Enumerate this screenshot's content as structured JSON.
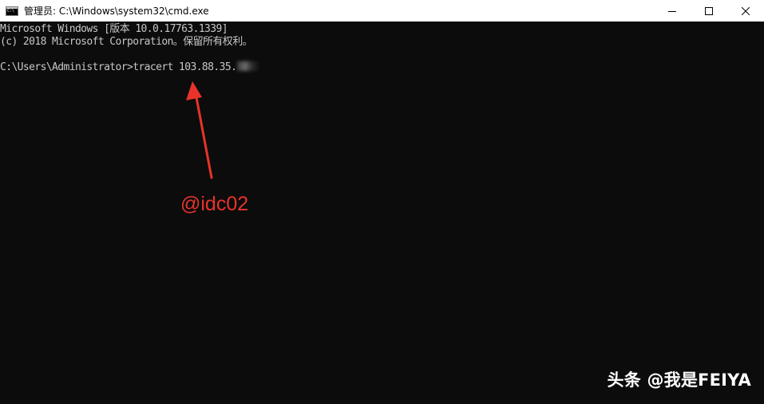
{
  "window": {
    "title": "管理员: C:\\Windows\\system32\\cmd.exe",
    "controls": {
      "minimize_icon": "minimize-icon",
      "maximize_icon": "maximize-icon",
      "close_icon": "close-icon"
    }
  },
  "console": {
    "lines": [
      "Microsoft Windows [版本 10.0.17763.1339]",
      "(c) 2018 Microsoft Corporation。保留所有权利。",
      "",
      "C:\\Users\\Administrator>tracert 103.88.35."
    ],
    "text_color": "#c7c7c7",
    "background": "#0c0c0c"
  },
  "annotation": {
    "text": "@idc02",
    "color": "#e8332a"
  },
  "watermark": {
    "text": "头条 @我是FEIYA"
  }
}
